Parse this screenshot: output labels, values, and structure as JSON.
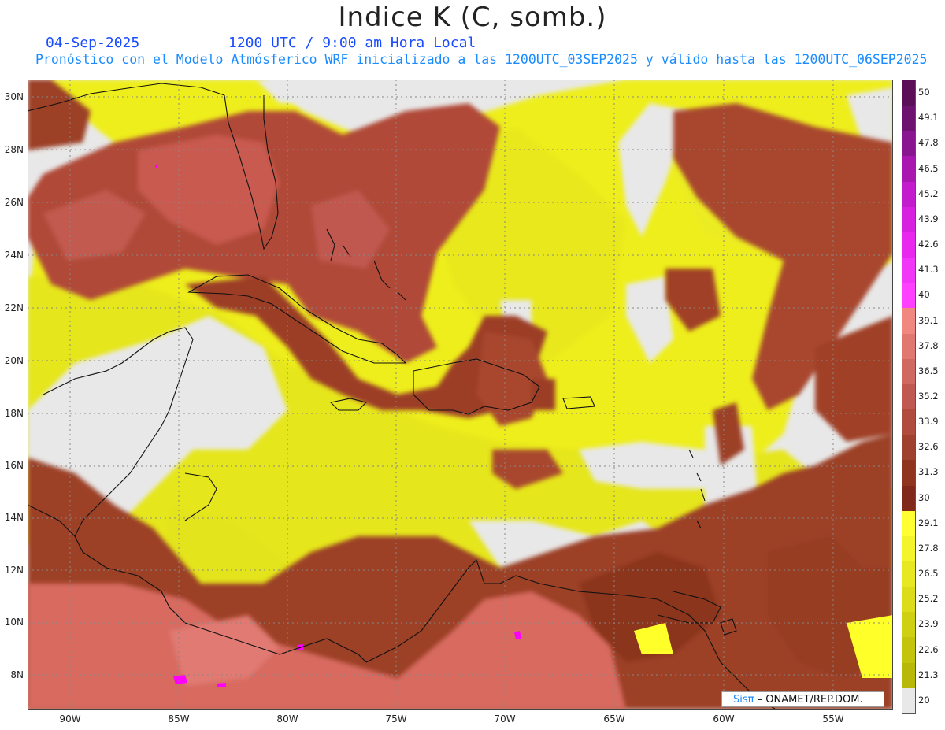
{
  "header": {
    "title": "Indice K (C, somb.)",
    "date": "04-Sep-2025",
    "time": "1200 UTC / 9:00 am Hora Local",
    "subtitle": "Pronóstico con el Modelo Atmósferico WRF inicializado a las 1200UTC_03SEP2025 y válido hasta las  1200UTC_06SEP2025"
  },
  "map": {
    "lat_labels": [
      "30N",
      "28N",
      "26N",
      "24N",
      "22N",
      "20N",
      "18N",
      "16N",
      "14N",
      "12N",
      "10N",
      "8N"
    ],
    "lon_labels": [
      "90W",
      "85W",
      "80W",
      "75W",
      "70W",
      "65W",
      "60W",
      "55W"
    ],
    "colors": {
      "gray": "#e8e8e8",
      "yellow_light": "#ffff2a",
      "yellow_mid": "#e8e81a",
      "olive": "#cccc10",
      "brown_dark": "#8b3a1f",
      "brown_mid": "#a8472f",
      "rust": "#bf5a4a",
      "salmon": "#e07068",
      "magenta": "#ff00ff"
    }
  },
  "colorbar": {
    "labels": [
      "50",
      "49.1",
      "47.8",
      "46.5",
      "45.2",
      "43.9",
      "42.6",
      "41.3",
      "40",
      "39.1",
      "37.8",
      "36.5",
      "35.2",
      "33.9",
      "32.6",
      "31.3",
      "30",
      "29.1",
      "27.8",
      "26.5",
      "25.2",
      "23.9",
      "22.6",
      "21.3",
      "20"
    ],
    "colors": [
      "#5a0f58",
      "#6e1270",
      "#8a1590",
      "#a818b0",
      "#c21ccc",
      "#d820e0",
      "#e828ee",
      "#f236f8",
      "#ff40ff",
      "#f08880",
      "#e07870",
      "#d06a60",
      "#c05a50",
      "#b04c3e",
      "#a0402e",
      "#903420",
      "#80281a",
      "#ffff33",
      "#f4f42a",
      "#e8e822",
      "#dcdc1a",
      "#d0d012",
      "#c4c40c",
      "#b8b808",
      "#e8e8e8"
    ]
  },
  "logo": {
    "sis": "Sisπ",
    "org": " – ONAMET/REP.DOM."
  }
}
